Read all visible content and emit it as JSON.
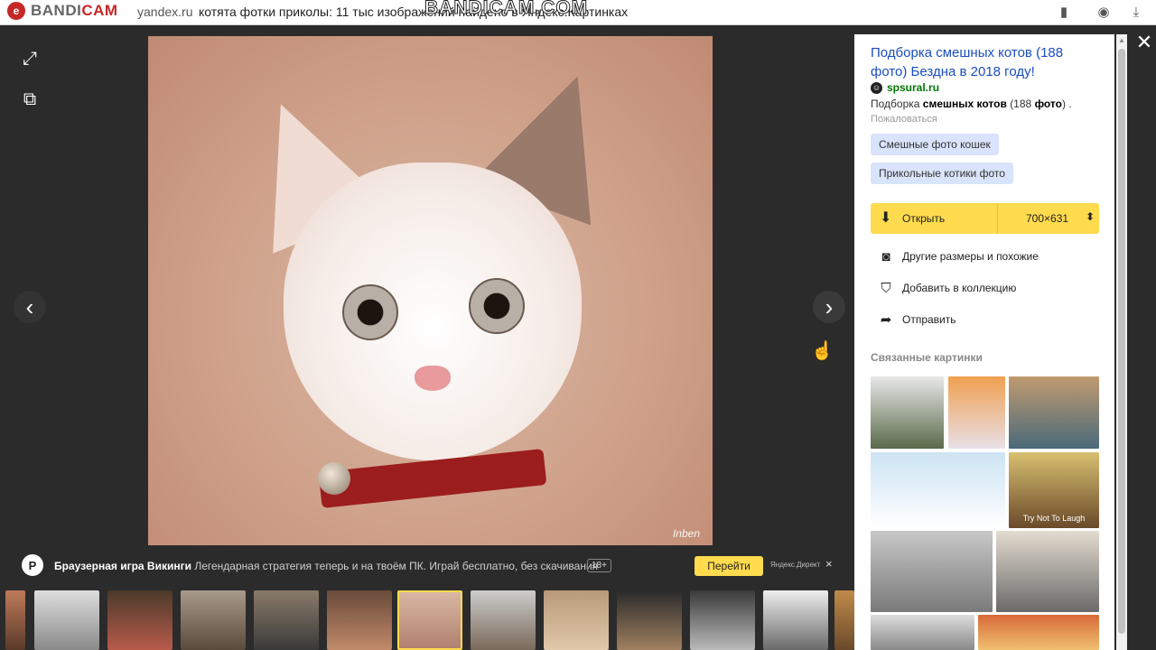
{
  "browser": {
    "domain": "yandex.ru",
    "title": "котята фотки приколы: 11 тыс изображений найдено в Яндекс.Картинках",
    "watermark": "BANDICAM.COM",
    "logo_letter": "e",
    "logo_word_a": "BANDI",
    "logo_word_b": "CAM"
  },
  "viewer": {
    "image_signature": "Inben",
    "prev_glyph": "‹",
    "next_glyph": "›"
  },
  "ad": {
    "logo_letter": "P",
    "name": "Браузерная игра Викинги",
    "text": "Легендарная стратегия теперь и на твоём ПК. Играй бесплатно, без скачивания",
    "age": "18+",
    "button": "Перейти",
    "direct": "Яндекс.Директ",
    "close": "×"
  },
  "sidebar": {
    "title": "Подборка смешных котов (188 фото) Бездна в 2018 году!",
    "source": "spsural.ru",
    "desc_prefix": "Подборка",
    "desc_bold1": "смешных котов",
    "desc_mid": "(188",
    "desc_bold2": "фото",
    "desc_suffix": ") .",
    "complain": "Пожаловаться",
    "tags": [
      "Смешные фото кошек",
      "Прикольные котики фото"
    ],
    "open_label": "Открыть",
    "size_label": "700×631",
    "actions": [
      {
        "icon": "camera-icon",
        "label": "Другие размеры и похожие"
      },
      {
        "icon": "bookmark-icon",
        "label": "Добавить в коллекцию"
      },
      {
        "icon": "share-arrow-icon",
        "label": "Отправить"
      }
    ],
    "related_heading": "Связанные картинки",
    "related_caption": "Try Not To Laugh"
  },
  "colors": {
    "accent_yellow": "#ffdb4d",
    "link_blue": "#1a4dbf",
    "source_green": "#007700",
    "tag_bg": "#d9e3fb"
  }
}
